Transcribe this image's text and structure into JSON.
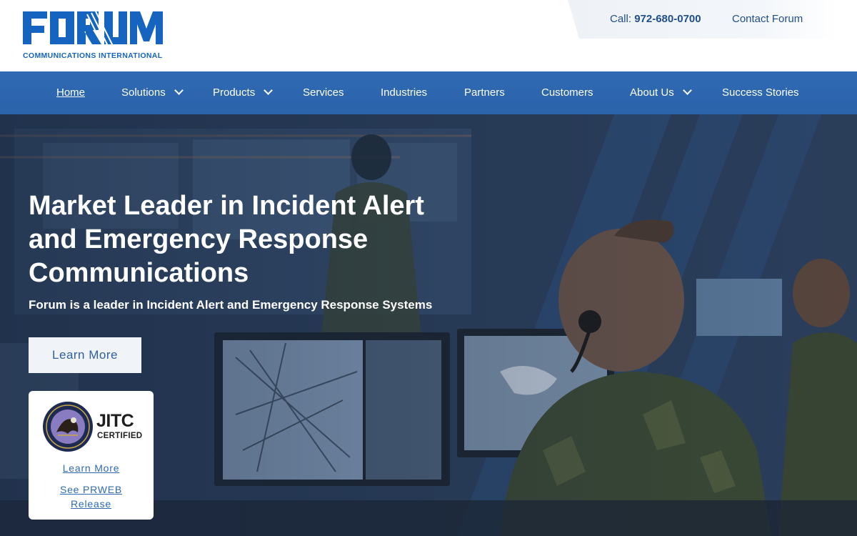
{
  "header": {
    "logo_word": "FORUM",
    "logo_sub": "COMMUNICATIONS INTERNATIONAL",
    "call_label": "Call:",
    "phone": "972-680-0700",
    "contact_link": "Contact Forum"
  },
  "nav": {
    "items": [
      {
        "label": "Home",
        "active": true,
        "dropdown": false
      },
      {
        "label": "Solutions",
        "dropdown": true
      },
      {
        "label": "Products",
        "dropdown": true
      },
      {
        "label": "Services",
        "dropdown": false
      },
      {
        "label": "Industries",
        "dropdown": false
      },
      {
        "label": "Partners",
        "dropdown": false
      },
      {
        "label": "Customers",
        "dropdown": false
      },
      {
        "label": "About Us",
        "dropdown": true
      },
      {
        "label": "Success Stories",
        "dropdown": false
      }
    ]
  },
  "hero": {
    "headline": "Market Leader in Incident Alert and Emergency Response Communications",
    "subhead": "Forum is a leader in Incident Alert and Emergency Response Systems",
    "cta_label": "Learn More"
  },
  "jitc_card": {
    "badge_title": "JITC",
    "badge_sub": "CERTIFIED",
    "learn_more": "Learn More",
    "prweb_line1": "See PRWEB",
    "prweb_line2": "Release"
  },
  "colors": {
    "brand_blue": "#1565c0",
    "nav_blue": "#2f6ab3",
    "link_blue": "#1f4e8c",
    "white": "#ffffff"
  }
}
